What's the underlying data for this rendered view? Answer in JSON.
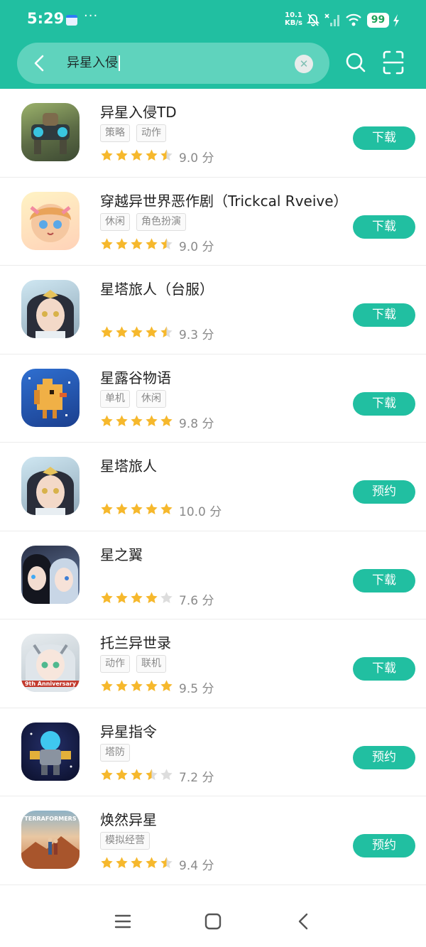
{
  "status": {
    "time": "5:29",
    "speed_value": "10.1",
    "speed_unit": "KB/s",
    "battery": "99",
    "dots": "···"
  },
  "search": {
    "query": "异星入侵",
    "clear_icon": "✕"
  },
  "colors": {
    "accent": "#21bfa1",
    "star": "#f6b82c",
    "star_empty": "#dddddd"
  },
  "results": [
    {
      "title": "异星入侵TD",
      "tags": [
        "策略",
        "动作"
      ],
      "rating": 4.5,
      "score": "9.0 分",
      "button": "下载",
      "icon": "mech-turret-icon"
    },
    {
      "title": "穿越异世界恶作剧（Trickcal Rveive）",
      "tags": [
        "休闲",
        "角色扮演"
      ],
      "rating": 4.5,
      "score": "9.0 分",
      "button": "下载",
      "icon": "anime-girl-icon"
    },
    {
      "title": "星塔旅人（台服）",
      "tags": [],
      "rating": 4.5,
      "score": "9.3 分",
      "button": "下载",
      "icon": "anime-character-icon"
    },
    {
      "title": "星露谷物语",
      "tags": [
        "单机",
        "休闲"
      ],
      "rating": 5,
      "score": "9.8 分",
      "button": "下载",
      "icon": "pixel-chicken-icon"
    },
    {
      "title": "星塔旅人",
      "tags": [],
      "rating": 5,
      "score": "10.0 分",
      "button": "预约",
      "icon": "anime-character-icon"
    },
    {
      "title": "星之翼",
      "tags": [],
      "rating": 4,
      "score": "7.6 分",
      "button": "下载",
      "icon": "anime-duo-icon"
    },
    {
      "title": "托兰异世录",
      "tags": [
        "动作",
        "联机"
      ],
      "rating": 5,
      "score": "9.5 分",
      "button": "下载",
      "icon": "anniversary-girl-icon",
      "icon_badge": "9th Anniversary"
    },
    {
      "title": "异星指令",
      "tags": [
        "塔防"
      ],
      "rating": 3.5,
      "score": "7.2 分",
      "button": "预约",
      "icon": "robot-soldier-icon"
    },
    {
      "title": "焕然异星",
      "tags": [
        "模拟经营"
      ],
      "rating": 4.5,
      "score": "9.4 分",
      "button": "预约",
      "icon": "desert-explorers-icon",
      "icon_badge": "TERRAFORMERS"
    }
  ]
}
